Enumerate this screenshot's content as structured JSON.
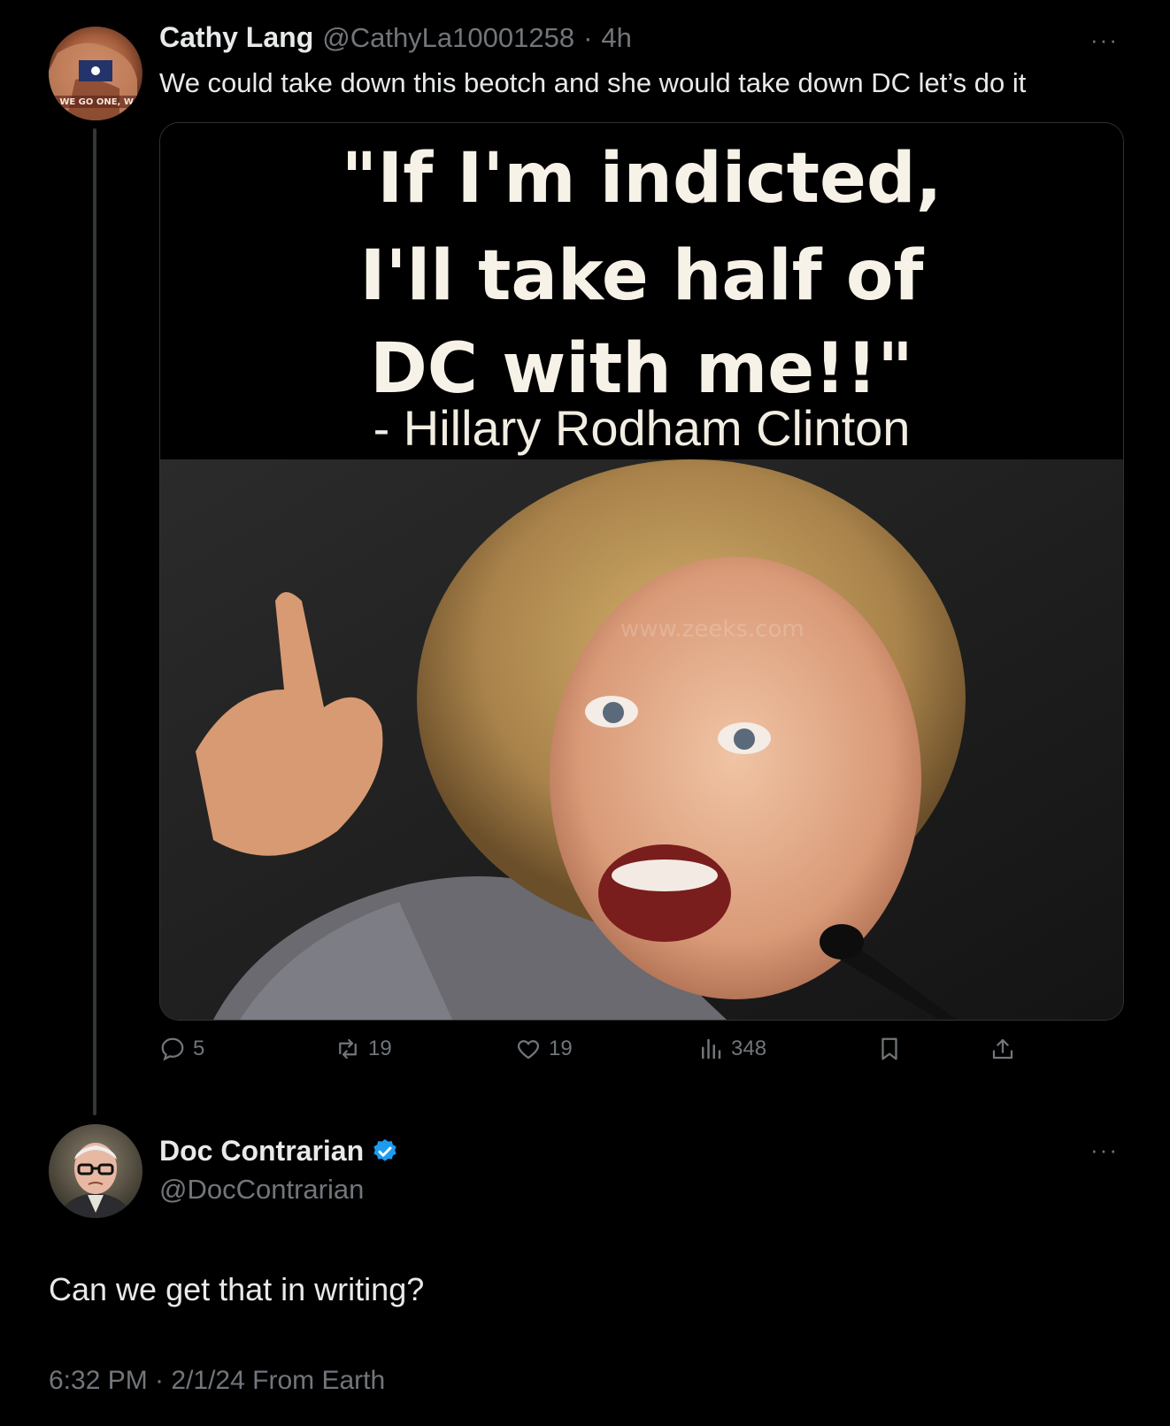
{
  "tweet1": {
    "name": "Cathy Lang",
    "handle": "@CathyLa10001258",
    "separator": "·",
    "time": "4h",
    "more": "···",
    "text": "We could take down this beotch and she would take down DC let’s do it",
    "avatar_text": "E WE GO ONE, W",
    "media": {
      "quote_lines": [
        "\"If I'm indicted,",
        "I'll take half of",
        "DC with me!!\""
      ],
      "attribution": "- Hillary Rodham Clinton",
      "watermark": "www.zeeks.com"
    },
    "actions": {
      "replies": "5",
      "reposts": "19",
      "likes": "19",
      "views": "348"
    }
  },
  "tweet2": {
    "name": "Doc Contrarian",
    "handle": "@DocContrarian",
    "more": "···",
    "verified": true,
    "text": "Can we get that in writing?",
    "timestamp": "6:32 PM · 2/1/24 From Earth"
  },
  "colors": {
    "background": "#000000",
    "text_primary": "#e7e9ea",
    "text_secondary": "#71767b",
    "verified_blue": "#1d9bf0",
    "divider": "#2f3336"
  },
  "icons": [
    "reply-icon",
    "repost-icon",
    "like-icon",
    "views-icon",
    "bookmark-icon",
    "share-icon",
    "verified-badge-icon",
    "more-icon"
  ]
}
